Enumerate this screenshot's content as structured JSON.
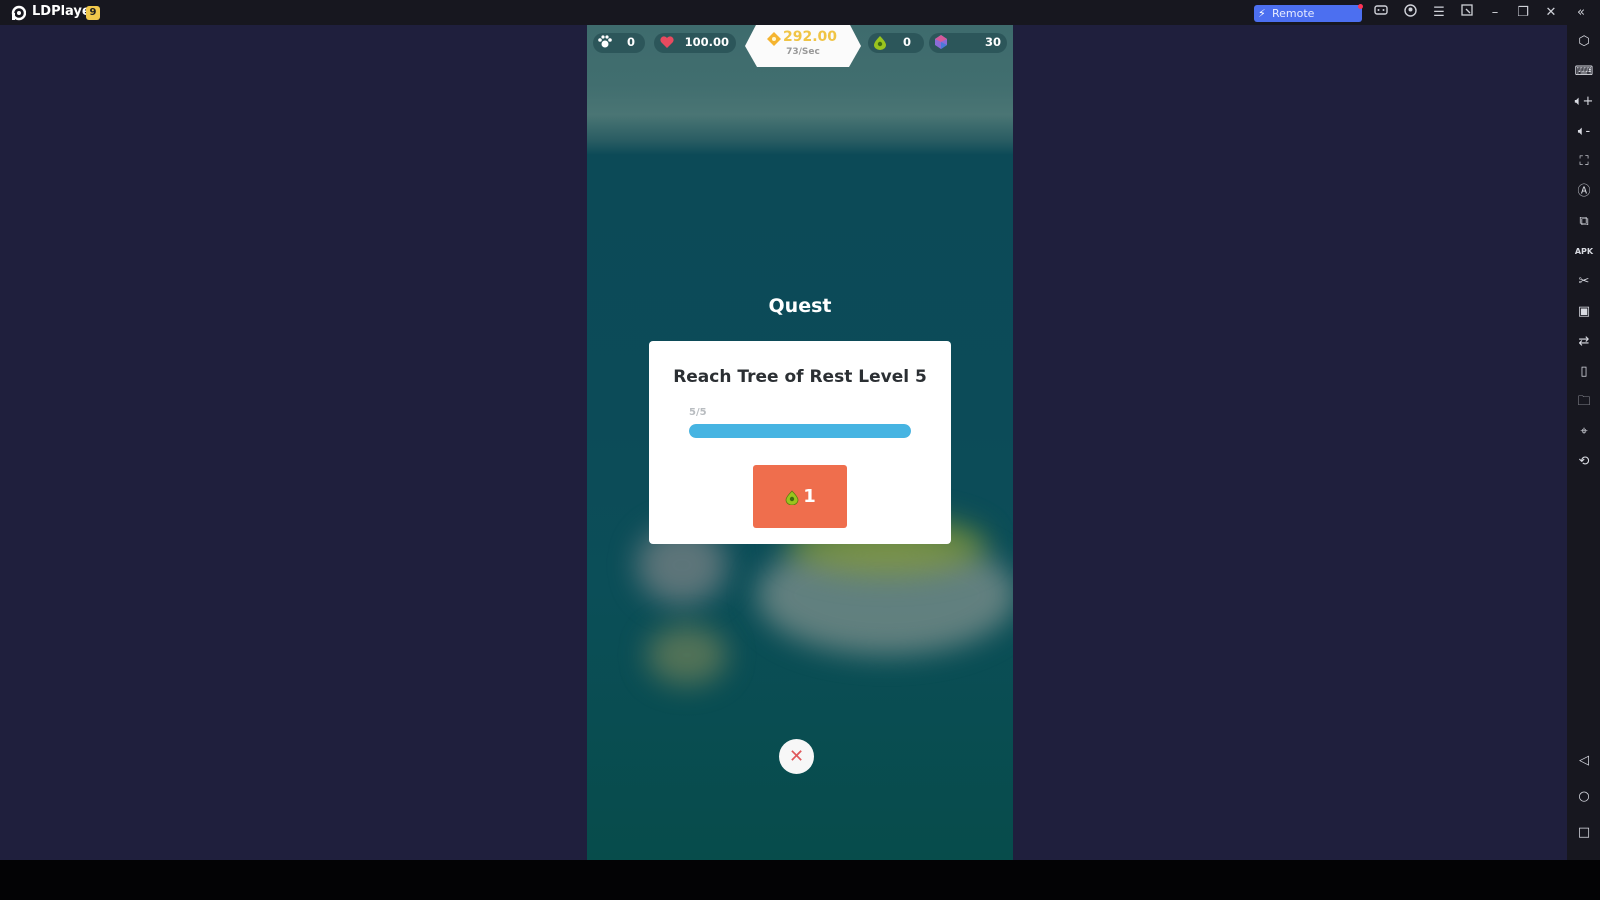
{
  "window": {
    "app_name": "LDPlayer",
    "version_badge": "9",
    "remote_button": "Remote LDPlayer",
    "controls": [
      "gamepad-icon",
      "account-icon",
      "menu-icon",
      "screen-record-icon",
      "minimize-icon",
      "restore-icon",
      "close-icon",
      "collapse-sidebar-icon"
    ]
  },
  "sidebar": {
    "tools": [
      "settings-icon",
      "keyboard-mapping-icon",
      "volume-up-icon",
      "volume-down-icon",
      "fullscreen-icon",
      "auto-rotate-icon",
      "multi-instance-icon",
      "install-apk-icon",
      "screenshot-scissors-icon",
      "video-record-icon",
      "operation-record-icon",
      "shake-icon",
      "shared-folder-icon",
      "location-icon",
      "rotate-screen-icon"
    ],
    "nav": [
      "back-icon",
      "home-icon",
      "recents-icon"
    ]
  },
  "hud": {
    "paw_count": "0",
    "health": "100.00",
    "coins": "292.00",
    "coin_rate": "73/Sec",
    "seeds": "0",
    "gems": "30"
  },
  "quest": {
    "heading": "Quest",
    "description": "Reach Tree of Rest Level 5",
    "progress_text": "5/5",
    "progress_fraction": 1.0,
    "reward_amount": "1",
    "reward_icon": "seed-icon"
  },
  "colors": {
    "accent_progress": "#46b4e2",
    "reward_button": "#ef6e4d",
    "coin_text": "#f0c445",
    "close_x": "#e0575a"
  }
}
